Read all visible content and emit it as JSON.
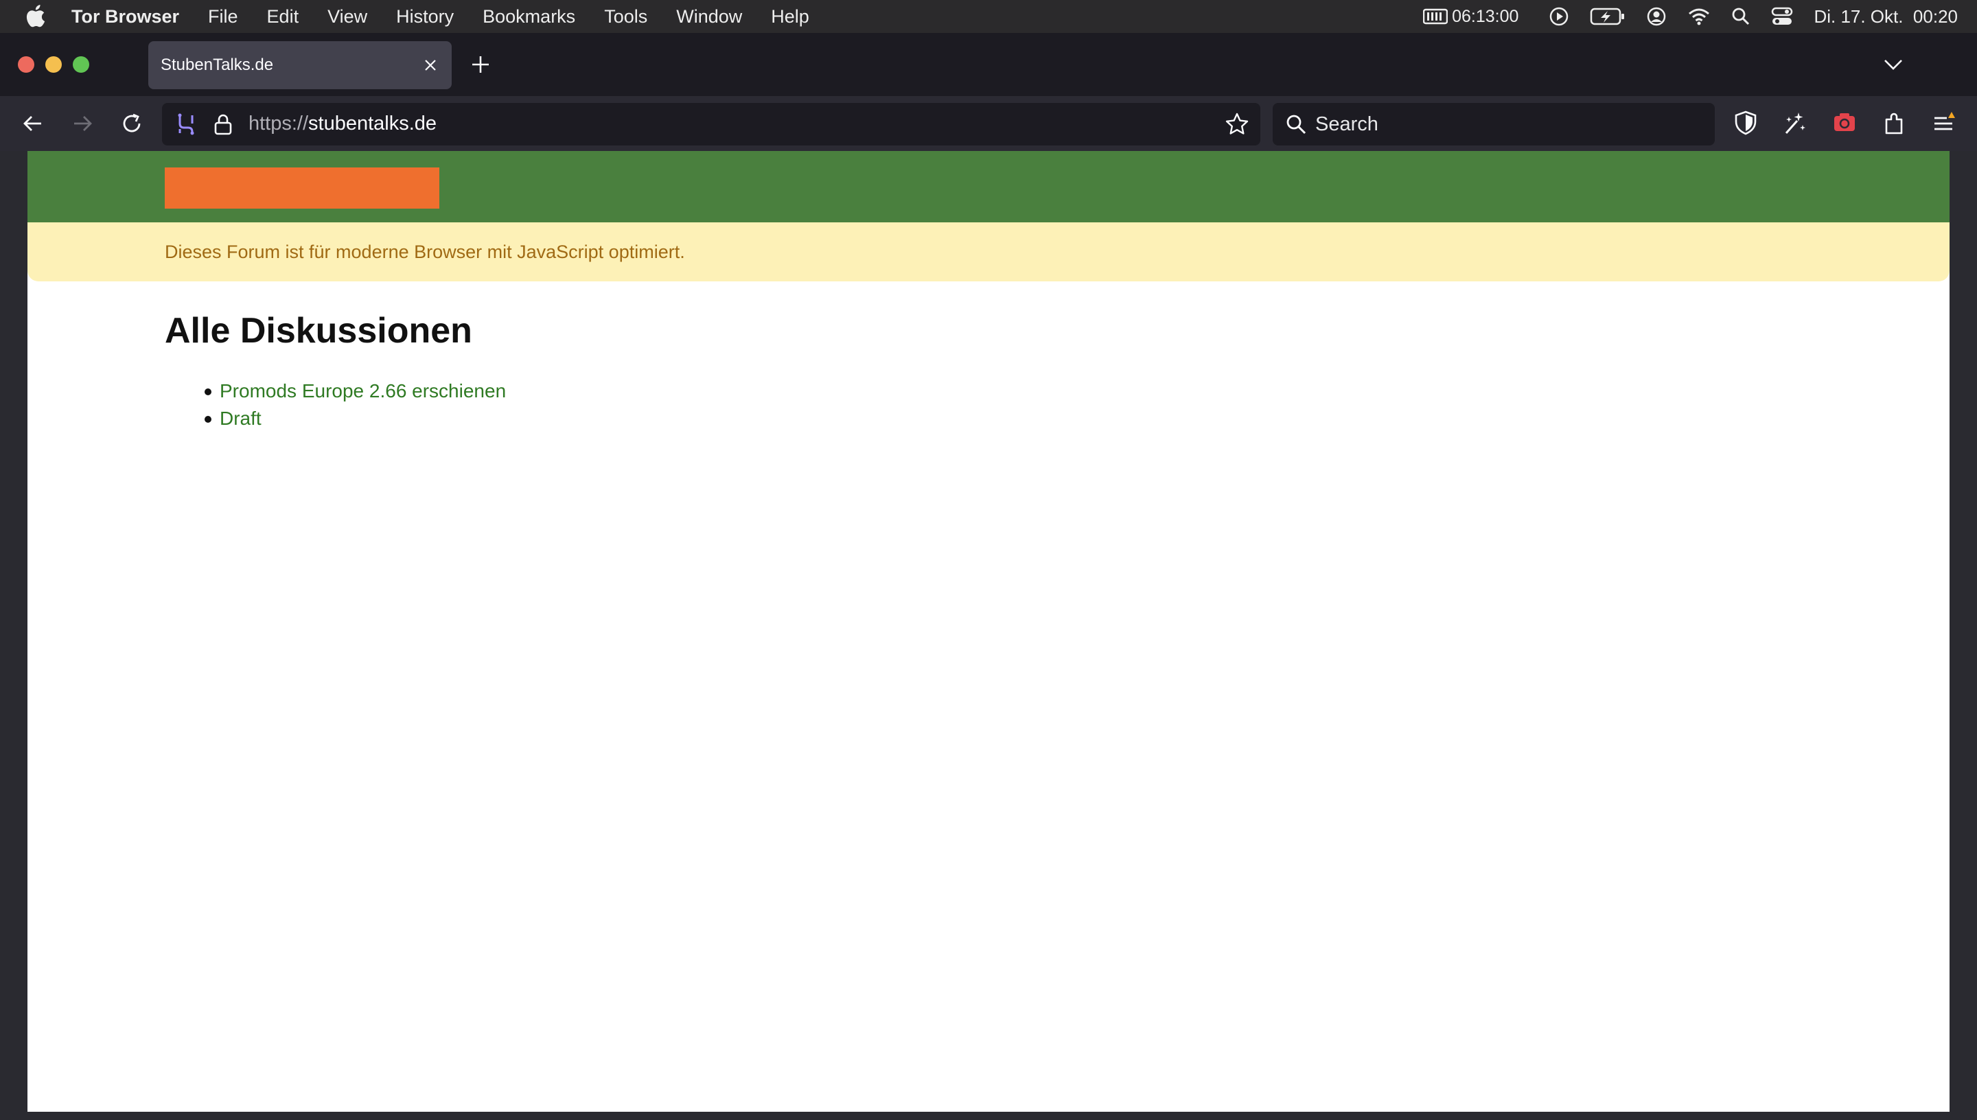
{
  "menubar": {
    "app_name": "Tor Browser",
    "items": [
      "File",
      "Edit",
      "View",
      "History",
      "Bookmarks",
      "Tools",
      "Window",
      "Help"
    ],
    "timer": "06:13:00",
    "clock": "Di. 17. Okt.  00:20"
  },
  "browser": {
    "tab_title": "StubenTalks.de",
    "url_scheme": "https://",
    "url_host": "stubentalks.de",
    "search_placeholder": "Search"
  },
  "page": {
    "notice": "Dieses Forum ist für moderne Browser mit JavaScript optimiert.",
    "title": "Alle Diskussionen",
    "discussions": [
      "Promods Europe 2.66 erschienen",
      "Draft"
    ]
  },
  "colors": {
    "header_green": "#4a803e",
    "logo_orange": "#ef6f2e",
    "notice_bg": "#fdf1b7",
    "notice_text": "#a06a14",
    "link_green": "#2f7a23"
  },
  "icons": {
    "menubar": [
      "apple-icon",
      "timer-icon",
      "play-icon",
      "battery-icon",
      "user-icon",
      "wifi-icon",
      "spotlight-icon",
      "control-center-icon"
    ],
    "toolbar": [
      "back-icon",
      "forward-icon",
      "reload-icon",
      "tor-circuit-icon",
      "lock-icon",
      "bookmark-star-icon",
      "search-icon",
      "shield-icon",
      "new-identity-icon",
      "screenshot-icon",
      "extensions-icon",
      "menu-icon"
    ]
  }
}
